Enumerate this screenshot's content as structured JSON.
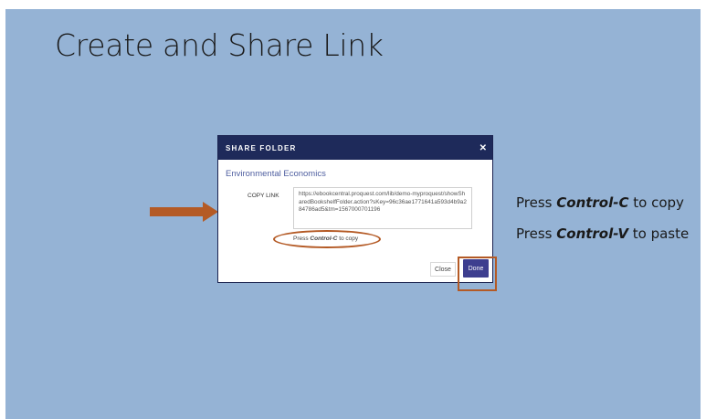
{
  "slide": {
    "title": "Create and Share Link",
    "background_color": "#95b3d5",
    "accent_color": "#b45a25"
  },
  "dialog": {
    "title": "SHARE FOLDER",
    "close_icon": "close-icon",
    "folder_name": "Environmental Economics",
    "copy_label": "COPY LINK",
    "link": "https://ebookcentral.proquest.com/lib/demo-myproquest/showSharedBookshelfFolder.action?sKey=96c36ae1771641a593d4b9a284786ad5&tm=1567000701196",
    "copy_hint_prefix": "Press ",
    "copy_hint_key": "Control-C",
    "copy_hint_suffix": " to copy",
    "close_button": "Close",
    "done_button": "Done",
    "header_color": "#1e2a5a",
    "done_color": "#3d3e8f"
  },
  "instructions": [
    {
      "prefix": "Press ",
      "key": "Control-C",
      "suffix": " to copy"
    },
    {
      "prefix": "Press ",
      "key": "Control-V",
      "suffix": " to paste"
    }
  ]
}
